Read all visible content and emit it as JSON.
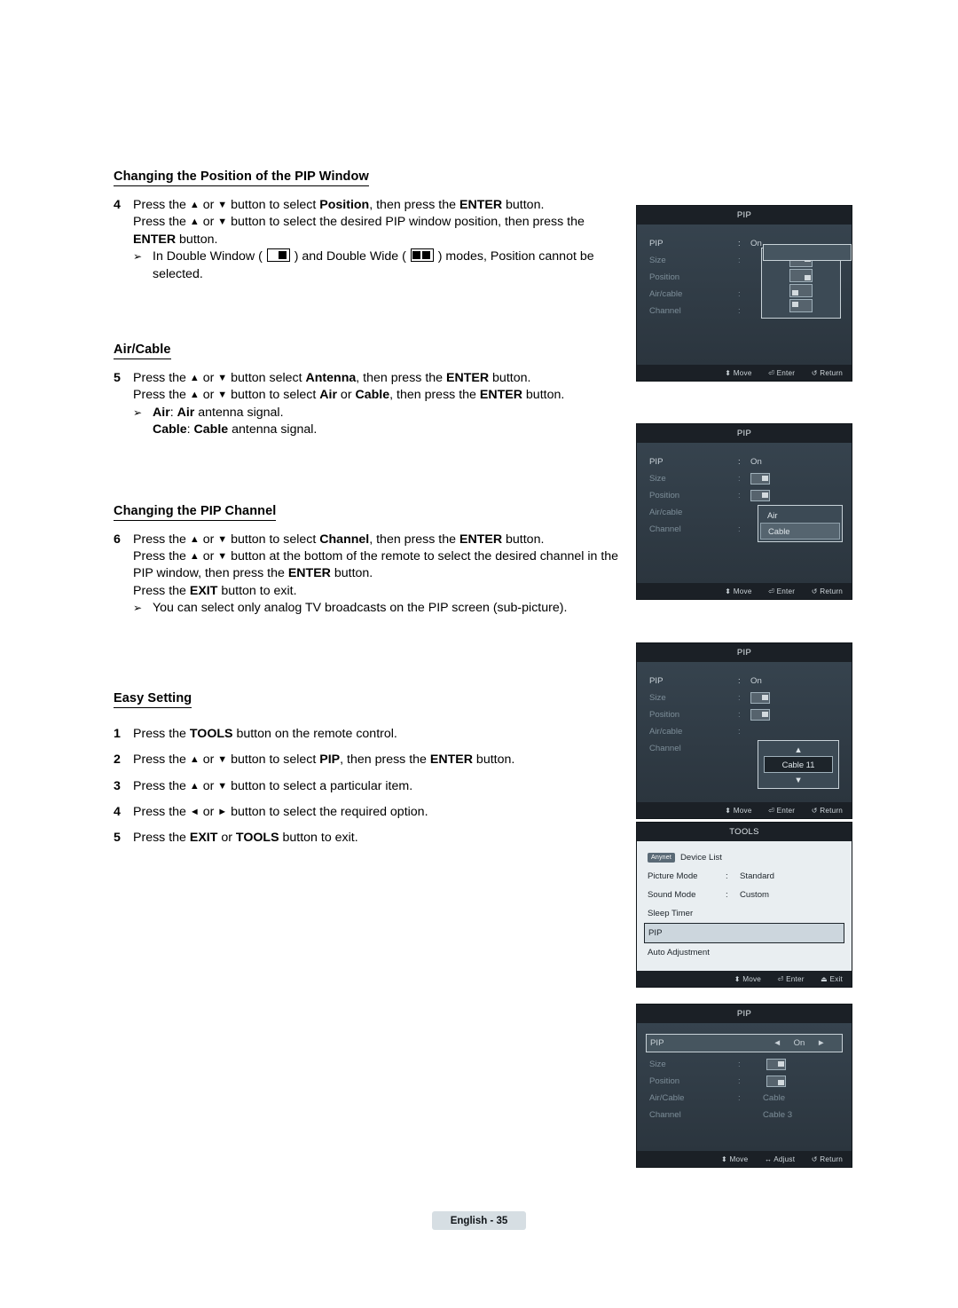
{
  "document": {
    "page_label": "English - 35"
  },
  "sections": [
    {
      "heading": "Changing the Position of the PIP Window",
      "steps": [
        {
          "num": "4",
          "lines": [
            "Press the ▲ or ▼ button to select Position, then press the ENTER button.",
            "Press the ▲ or ▼ button to select the desired PIP window position, then press the ENTER button."
          ]
        }
      ],
      "bullets": [
        "In Double Window ( ) and Double Wide ( ) modes, Position cannot be selected."
      ]
    },
    {
      "heading": "Air/Cable",
      "steps": [
        {
          "num": "5",
          "lines": [
            "Press the ▲ or ▼ button select Antenna, then press the ENTER button.",
            "Press the ▲ or ▼ button to select Air or Cable, then press the ENTER button."
          ]
        }
      ],
      "bullets": [
        "Air: Air antenna signal.",
        "Cable: Cable antenna signal."
      ]
    },
    {
      "heading": "Changing the PIP Channel",
      "steps": [
        {
          "num": "6",
          "lines": [
            "Press the ▲ or ▼ button to select Channel, then press the ENTER button.",
            "Press the ▲ or ▼ button at the bottom of the remote to select the desired channel in the PIP window, then press the ENTER button.",
            "Press the EXIT button to exit."
          ]
        }
      ],
      "bullets": [
        "You can select only analog TV broadcasts on the PIP screen (sub-picture)."
      ]
    },
    {
      "heading": "Easy Setting",
      "numbered": [
        {
          "num": "1",
          "text": "Press the TOOLS button on the remote control."
        },
        {
          "num": "2",
          "text": "Press the ▲ or ▼ button to select PIP, then press the ENTER button."
        },
        {
          "num": "3",
          "text": "Press the ▲ or ▼ button to select a particular item."
        },
        {
          "num": "4",
          "text": "Press the ◄ or ► button to select the required option."
        },
        {
          "num": "5",
          "text": "Press the EXIT or TOOLS button to exit."
        }
      ]
    }
  ],
  "osd_panels": [
    {
      "id": "pip-position",
      "title": "PIP",
      "rows": [
        {
          "label": "PIP",
          "colon": ":",
          "value": "On",
          "dim": false
        },
        {
          "label": "Size",
          "colon": ":",
          "value": "",
          "dim": true
        },
        {
          "label": "Position",
          "colon": "",
          "value": "",
          "dim": true
        },
        {
          "label": "Air/cable",
          "colon": ":",
          "value": "",
          "dim": true
        },
        {
          "label": "Channel",
          "colon": ":",
          "value": "",
          "dim": true
        }
      ],
      "footer": [
        "Move",
        "Enter",
        "Return"
      ]
    },
    {
      "id": "pip-aircable",
      "title": "PIP",
      "rows": [
        {
          "label": "PIP",
          "colon": ":",
          "value": "On",
          "dim": false
        },
        {
          "label": "Size",
          "colon": ":",
          "value": "",
          "dim": true
        },
        {
          "label": "Position",
          "colon": ":",
          "value": "",
          "dim": true
        },
        {
          "label": "Air/cable",
          "colon": "",
          "value": "",
          "dim": true
        },
        {
          "label": "Channel",
          "colon": ":",
          "value": "",
          "dim": true
        }
      ],
      "popup_options": [
        "Air",
        "Cable"
      ],
      "popup_selected": "Cable",
      "footer": [
        "Move",
        "Enter",
        "Return"
      ]
    },
    {
      "id": "pip-channel",
      "title": "PIP",
      "rows": [
        {
          "label": "PIP",
          "colon": ":",
          "value": "On",
          "dim": false
        },
        {
          "label": "Size",
          "colon": ":",
          "value": "",
          "dim": true
        },
        {
          "label": "Position",
          "colon": ":",
          "value": "",
          "dim": true
        },
        {
          "label": "Air/cable",
          "colon": ":",
          "value": "",
          "dim": true
        },
        {
          "label": "Channel",
          "colon": "",
          "value": "",
          "dim": true
        }
      ],
      "channel_value": "Cable 11",
      "footer": [
        "Move",
        "Enter",
        "Return"
      ]
    },
    {
      "id": "tools-menu",
      "title": "TOOLS",
      "device_list_label": "Device List",
      "device_chip": "Anynet",
      "rows": [
        {
          "label": "Picture Mode",
          "colon": ":",
          "value": "Standard"
        },
        {
          "label": "Sound Mode",
          "colon": ":",
          "value": "Custom"
        },
        {
          "label": "Sleep Timer",
          "colon": "",
          "value": ""
        },
        {
          "label": "PIP",
          "colon": "",
          "value": "",
          "selected": true
        },
        {
          "label": "Auto Adjustment",
          "colon": "",
          "value": ""
        }
      ],
      "footer": [
        "Move",
        "Enter",
        "Exit"
      ]
    },
    {
      "id": "pip-easy-setting",
      "title": "PIP",
      "rows": [
        {
          "label": "PIP",
          "colon": "",
          "value": "On",
          "dim": false,
          "selected": true
        },
        {
          "label": "Size",
          "colon": ":",
          "value": "",
          "dim": true
        },
        {
          "label": "Position",
          "colon": ":",
          "value": "",
          "dim": true
        },
        {
          "label": "Air/Cable",
          "colon": ":",
          "value": "Cable",
          "dim": true
        },
        {
          "label": "Channel",
          "colon": "",
          "value": "Cable 3",
          "dim": true
        }
      ],
      "footer": [
        "Move",
        "Adjust",
        "Return"
      ]
    }
  ],
  "icons": {
    "move": "⬍",
    "enter": "⏎",
    "return": "↺",
    "exit": "⏏",
    "adjust": "↔",
    "arrow_left": "◄",
    "arrow_right": "►"
  }
}
